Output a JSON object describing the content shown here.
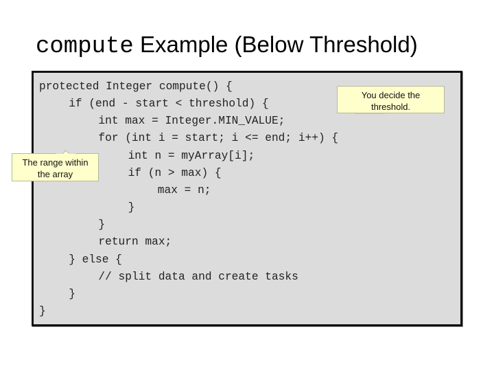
{
  "slide": {
    "title_code": "compute",
    "title_text": " Example (Below Threshold)"
  },
  "code": {
    "lines": [
      {
        "indent": 0,
        "text": "protected Integer compute() {"
      },
      {
        "indent": 1,
        "text": "if (end - start < threshold) {"
      },
      {
        "indent": 2,
        "text": "int max = Integer.MIN_VALUE;"
      },
      {
        "indent": 2,
        "text": "for (int i = start; i <= end; i++) {"
      },
      {
        "indent": 3,
        "text": "int n = myArray[i];"
      },
      {
        "indent": 3,
        "text": "if (n > max) {"
      },
      {
        "indent": 4,
        "text": "max = n;"
      },
      {
        "indent": 3,
        "text": "}"
      },
      {
        "indent": 2,
        "text": "}"
      },
      {
        "indent": 2,
        "text": "return max;"
      },
      {
        "indent": 1,
        "text": "} else {"
      },
      {
        "indent": 2,
        "text": "// split data and create tasks"
      },
      {
        "indent": 1,
        "text": "}"
      },
      {
        "indent": 0,
        "text": "}"
      }
    ]
  },
  "callouts": {
    "threshold": {
      "line1": "You decide the",
      "line2": "threshold."
    },
    "range": {
      "line1": "The range within",
      "line2": "the array"
    }
  }
}
